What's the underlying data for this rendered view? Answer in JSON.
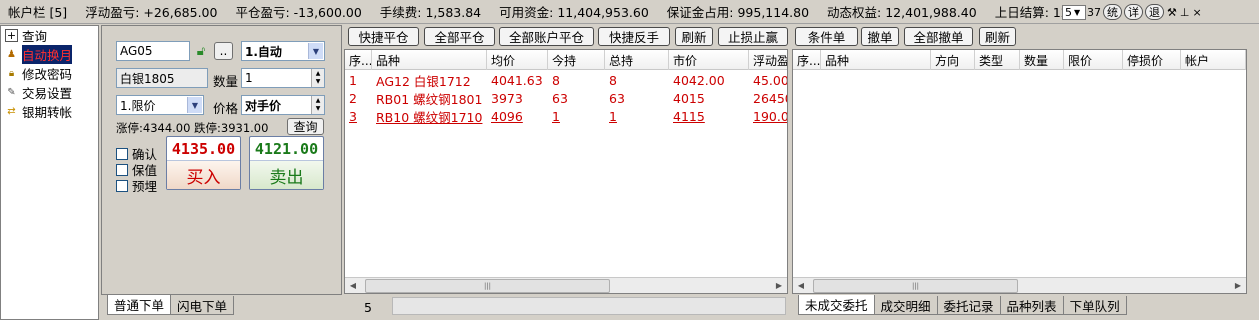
{
  "account_bar": {
    "title": "帐户栏 [5]",
    "items": [
      "浮动盈亏: +26,685.00",
      "平仓盈亏: -13,600.00",
      "手续费: 1,583.84",
      "可用资金: 11,404,953.60",
      "保证金占用: 995,114.80",
      "动态权益: 12,401,988.40",
      "上日结算: 12,39"
    ],
    "select_value": "5",
    "buttons": [
      "统",
      "详",
      "退"
    ],
    "tool_icons": [
      "⊘",
      "✎",
      "⚙",
      "ⅹ",
      "ꟼ",
      "×"
    ]
  },
  "nav": {
    "items": [
      {
        "icon": "plus-box",
        "label": "查询"
      },
      {
        "icon": "person",
        "label": "自动换月",
        "selected": true
      },
      {
        "icon": "lock",
        "label": "修改密码"
      },
      {
        "icon": "wrench",
        "label": "交易设置"
      },
      {
        "icon": "swap",
        "label": "银期转帐"
      }
    ]
  },
  "order": {
    "contract_code": "AG05",
    "contract_name": "白银1805",
    "lock_icon": "lock-open-icon",
    "dots_label": "..",
    "mode_value": "1.自动",
    "quantity_label": "数量",
    "quantity_value": "1",
    "price_type_value": "1.限价",
    "price_label": "价格",
    "price_value": "对手价",
    "limit_up_text": "涨停:4344.00",
    "limit_down_text": "跌停:3931.00",
    "query_label": "查询",
    "checkboxes": [
      "确认",
      "保值",
      "预埋"
    ],
    "buy": {
      "price": "4135.00",
      "label": "买入"
    },
    "sell": {
      "price": "4121.00",
      "label": "卖出"
    },
    "colors": {
      "buy": "#cc0000",
      "sell": "#1a7a1a"
    }
  },
  "order_tabs": [
    "普通下单",
    "闪电下单"
  ],
  "position_toolbar": [
    "快捷平仓",
    "全部平仓",
    "全部账户平仓",
    "快捷反手",
    "刷新",
    "止损止赢"
  ],
  "positions": {
    "columns": [
      "序...",
      "品种",
      "均价",
      "今持",
      "总持",
      "市价",
      "浮动盈"
    ],
    "rows": [
      {
        "idx": "1",
        "symbol": "AG12 白银1712",
        "avg": "4041.63",
        "today": "8",
        "total": "8",
        "market": "4042.00",
        "pnl": "45.00",
        "underline": false
      },
      {
        "idx": "2",
        "symbol": "RB01 螺纹钢1801",
        "avg": "3973",
        "today": "63",
        "total": "63",
        "market": "4015",
        "pnl": "26450",
        "underline": false
      },
      {
        "idx": "3",
        "symbol": "RB10 螺纹钢1710",
        "avg": "4096",
        "today": "1",
        "total": "1",
        "market": "4115",
        "pnl": "190.0",
        "underline": true
      }
    ],
    "footer_value": "5"
  },
  "orders_toolbar": [
    "条件单",
    "撤单",
    "全部撤单",
    "刷新"
  ],
  "orders": {
    "columns": [
      "序...",
      "品种",
      "方向",
      "类型",
      "数量",
      "限价",
      "停损价",
      "帐户"
    ]
  },
  "orders_tabs": [
    "未成交委托",
    "成交明细",
    "委托记录",
    "品种列表",
    "下单队列"
  ]
}
